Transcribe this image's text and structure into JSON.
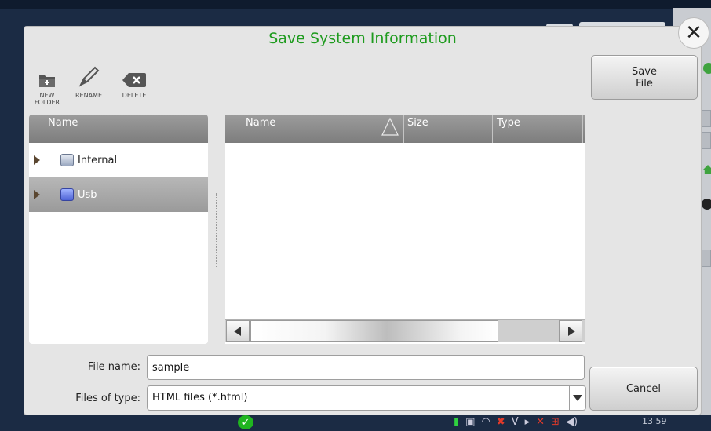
{
  "dialog": {
    "title": "Save System Information",
    "close_glyph": "✕"
  },
  "toolbar": {
    "new_folder_label": "NEW\nFOLDER",
    "rename_label": "RENAME",
    "delete_label": "DELETE",
    "icons": [
      "new-folder-icon",
      "rename-pencil-icon",
      "delete-backspace-icon"
    ]
  },
  "buttons": {
    "save_file": "Save\nFile",
    "cancel": "Cancel"
  },
  "tree": {
    "header": "Name",
    "items": [
      {
        "label": "Internal",
        "icon": "drive-icon",
        "selected": false
      },
      {
        "label": "Usb",
        "icon": "usb-drive-icon",
        "selected": true
      }
    ]
  },
  "files": {
    "columns": [
      "Name",
      "Size",
      "Type"
    ],
    "sort_column": "Name",
    "rows": []
  },
  "form": {
    "file_name_label": "File name:",
    "file_name_value": "sample",
    "files_of_type_label": "Files of type:",
    "files_of_type_value": "HTML files (*.html)"
  },
  "statusbar": {
    "clock": "13 59"
  },
  "colors": {
    "title_green": "#1e9b1e",
    "header_gray": "#8c8c8c",
    "selected_row": "#a8a8a8",
    "status_ok": "#1fb51f"
  }
}
